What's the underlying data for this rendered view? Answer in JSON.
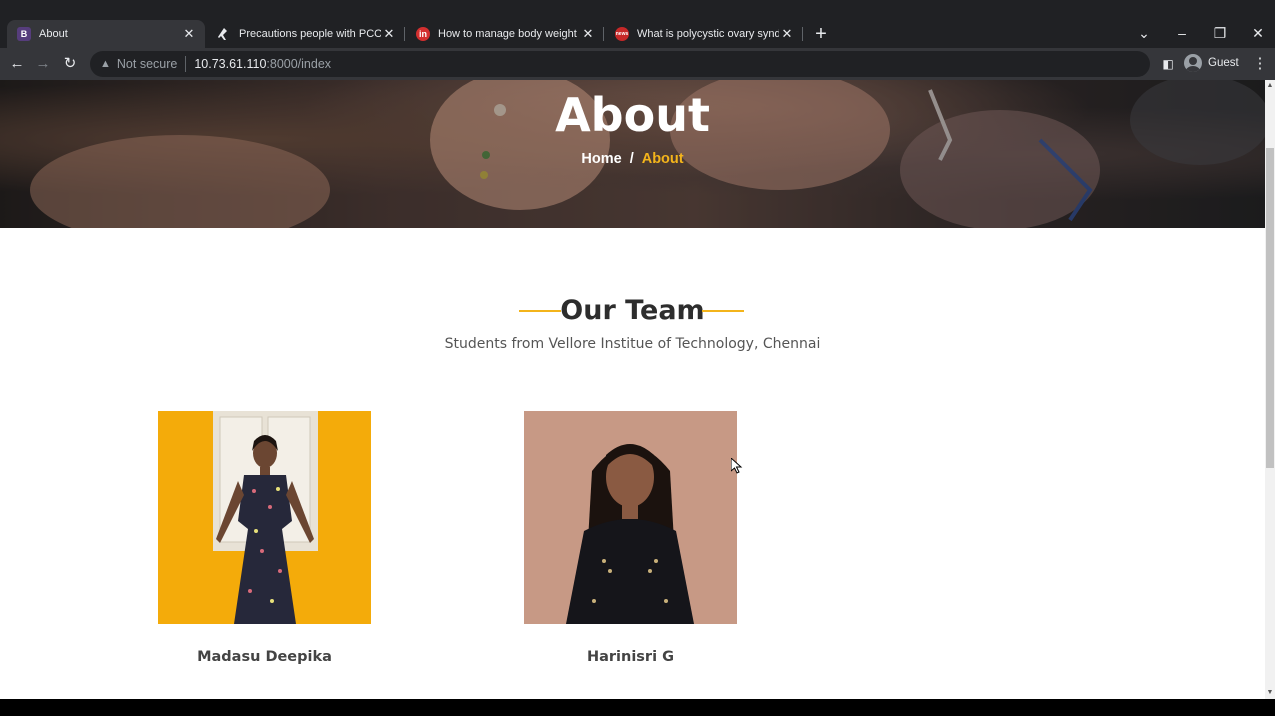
{
  "browser": {
    "tabs": [
      {
        "title": "About",
        "favicon": "B",
        "favicon_bg": "#563d7c",
        "active": true
      },
      {
        "title": "Precautions people with PCOS ca",
        "favicon": "yoga-icon",
        "active": false
      },
      {
        "title": "How to manage body weight if y",
        "favicon": "in",
        "favicon_bg": "#d32f2f",
        "active": false
      },
      {
        "title": "What is polycystic ovary syndrom",
        "favicon": "news",
        "favicon_bg": "#c62828",
        "active": false
      }
    ],
    "new_tab_label": "+",
    "address": {
      "security": "Not secure",
      "host": "10.73.61.110",
      "path": ":8000/index"
    },
    "profile": "Guest"
  },
  "hero": {
    "title": "About",
    "breadcrumb": {
      "home": "Home",
      "separator": "/",
      "current": "About"
    }
  },
  "team": {
    "heading": "Our Team",
    "subtitle": "Students from Vellore Institue of Technology, Chennai",
    "members": [
      {
        "name": "Madasu Deepika"
      },
      {
        "name": "Harinisri G"
      }
    ]
  },
  "colors": {
    "accent": "#f3b41b",
    "chrome_dark": "#202124",
    "chrome_tab": "#35363a"
  }
}
